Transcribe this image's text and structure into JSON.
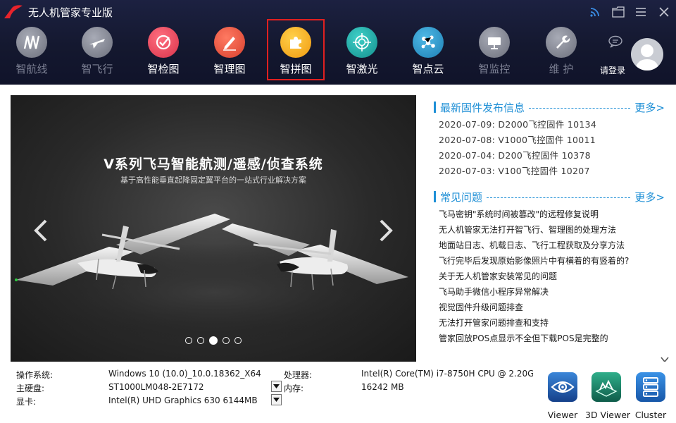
{
  "app": {
    "title": "无人机管家专业版"
  },
  "window_controls": [
    {
      "name": "rss-icon"
    },
    {
      "name": "folder-icon"
    },
    {
      "name": "menu-icon"
    },
    {
      "name": "close-icon"
    }
  ],
  "nav": [
    {
      "label": "智航线",
      "icon": "route-icon",
      "state": "dim"
    },
    {
      "label": "智飞行",
      "icon": "plane-icon",
      "state": "dim"
    },
    {
      "label": "智检图",
      "icon": "check-icon",
      "state": "lit",
      "color": "#e8455a"
    },
    {
      "label": "智理图",
      "icon": "pencil-icon",
      "state": "lit",
      "color": "#e94a3a"
    },
    {
      "label": "智拼图",
      "icon": "puzzle-icon",
      "state": "selected",
      "color": "#f4a81c"
    },
    {
      "label": "智激光",
      "icon": "laser-target-icon",
      "state": "lit",
      "color": "#1ea7a6"
    },
    {
      "label": "智点云",
      "icon": "point-cloud-icon",
      "state": "lit",
      "color": "#2d97c6"
    },
    {
      "label": "智监控",
      "icon": "monitor-icon",
      "state": "dim"
    },
    {
      "label": "维 护",
      "icon": "wrench-icon",
      "state": "dim"
    }
  ],
  "login": {
    "label": "请登录"
  },
  "banner": {
    "title": "V系列飞马智能航测/遥感/侦查系统",
    "subtitle": "基于高性能垂直起降固定翼平台的一站式行业解决方案",
    "slide_count": 5,
    "active_slide": 3
  },
  "firmware": {
    "title": "最新固件发布信息",
    "more": "更多>",
    "items": [
      "2020-07-09: D2000飞控固件 10134",
      "2020-07-08: V1000飞控固件 10011",
      "2020-07-04: D200飞控固件 10378",
      "2020-07-03: V100飞控固件 10207"
    ]
  },
  "faq": {
    "title": "常见问题",
    "more": "更多>",
    "items": [
      "飞马密钥\"系统时间被篡改\"的远程修复说明",
      "无人机管家无法打开智飞行、智理图的处理方法",
      "地面站日志、机载日志、飞行工程获取及分享方法",
      "飞行完毕后发现原始影像照片中有横着的有竖着的?",
      "关于无人机管家安装常见的问题",
      "飞马助手微信小程序异常解决",
      "视觉固件升级问题排查",
      "无法打开管家问题排查和支持",
      "管家回放POS点显示不全但下载POS是完整的"
    ]
  },
  "system_info": {
    "os_label": "操作系统:",
    "os_value": "Windows 10 (10.0)_10.0.18362_X64",
    "disk_label": "主硬盘:",
    "disk_value": "ST1000LM048-2E7172",
    "gpu_label": "显卡:",
    "gpu_value": "Intel(R) UHD Graphics 630 6144MB",
    "cpu_label": "处理器:",
    "cpu_value": "Intel(R) Core(TM) i7-8750H CPU @ 2.20GHz",
    "mem_label": "内存:",
    "mem_value": "16242 MB"
  },
  "tools": [
    {
      "label": "Viewer",
      "icon": "eye-icon",
      "color": "#1f5fae"
    },
    {
      "label": "3D Viewer",
      "icon": "terrain-3d-icon",
      "color": "#1b8f6e"
    },
    {
      "label": "Cluster",
      "icon": "server-cluster-icon",
      "color": "#1f6fc4"
    }
  ]
}
